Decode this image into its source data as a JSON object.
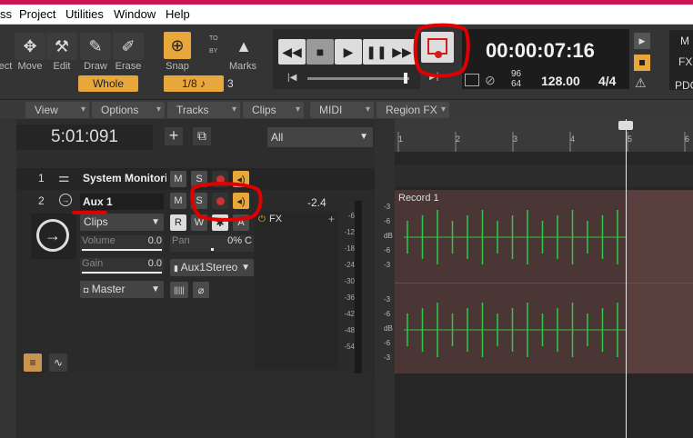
{
  "menu": [
    "ss",
    "Project",
    "Utilities",
    "Window",
    "Help"
  ],
  "tools": [
    {
      "label": "ect"
    },
    {
      "label": "Move",
      "icon": "move-icon"
    },
    {
      "label": "Edit",
      "icon": "wrench-icon"
    },
    {
      "label": "Draw",
      "icon": "pencil-icon"
    },
    {
      "label": "Erase",
      "icon": "eraser-icon"
    }
  ],
  "whole": "Whole",
  "snap": {
    "label": "Snap",
    "to": "TO",
    "by": "BY",
    "value": "1/8",
    "num": "3",
    "marks": "Marks"
  },
  "transport": {
    "time": "00:00:07:16",
    "tempo": "128.00",
    "sig": "4/4",
    "ts_top": "96",
    "ts_bot": "64"
  },
  "right": {
    "m": "M",
    "fx": "FX",
    "pdc": "PDC"
  },
  "viewbar": [
    "View",
    "Options",
    "Tracks",
    "Clips",
    "MIDI",
    "Region FX"
  ],
  "position": "5:01:091",
  "filter": "All",
  "ruler": [
    "1",
    "2",
    "3",
    "4",
    "5",
    "6"
  ],
  "tracks": [
    {
      "num": "1",
      "name": "System Monitorii"
    },
    {
      "num": "2",
      "name": "Aux 1"
    }
  ],
  "aux": {
    "clips": "Clips",
    "volume_label": "Volume",
    "volume": "0.0",
    "gain_label": "Gain",
    "gain": "0.0",
    "pan_label": "Pan",
    "pan": "0% C",
    "output": "Aux1Stereo",
    "master": "Master",
    "fx": "FX",
    "level": "-2.4",
    "db_scale": [
      "-6",
      "-12",
      "-18",
      "-24",
      "-30",
      "-36",
      "-42",
      "-48",
      "-54"
    ],
    "btn_m": "M",
    "btn_s": "S",
    "btn_r": "R",
    "btn_w": "W",
    "btn_a": "A"
  },
  "clip": {
    "name": "Record 1",
    "db": [
      "-3",
      "-6",
      "dB",
      "-6",
      "-3"
    ]
  },
  "annotation_color": "#e00000"
}
